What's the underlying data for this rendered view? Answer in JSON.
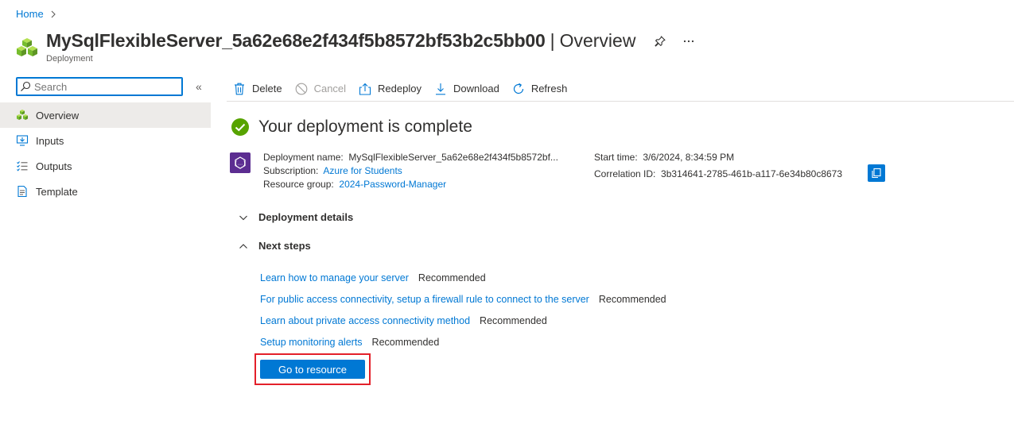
{
  "breadcrumb": {
    "home": "Home"
  },
  "header": {
    "title": "MySqlFlexibleServer_5a62e68e2f434f5b8572bf53b2c5bb00",
    "separator": "|",
    "section": "Overview",
    "subtitle": "Deployment"
  },
  "sidebar": {
    "search_placeholder": "Search",
    "collapse_glyph": "«",
    "items": [
      {
        "label": "Overview",
        "icon": "overview-icon",
        "active": true
      },
      {
        "label": "Inputs",
        "icon": "inputs-icon"
      },
      {
        "label": "Outputs",
        "icon": "outputs-icon"
      },
      {
        "label": "Template",
        "icon": "template-icon"
      }
    ]
  },
  "toolbar": {
    "delete": "Delete",
    "cancel": "Cancel",
    "redeploy": "Redeploy",
    "download": "Download",
    "refresh": "Refresh"
  },
  "status": {
    "text": "Your deployment is complete"
  },
  "details": {
    "deployment_name_label": "Deployment name:",
    "deployment_name": "MySqlFlexibleServer_5a62e68e2f434f5b8572bf...",
    "subscription_label": "Subscription:",
    "subscription": "Azure for Students",
    "resource_group_label": "Resource group:",
    "resource_group": "2024-Password-Manager",
    "start_time_label": "Start time:",
    "start_time": "3/6/2024, 8:34:59 PM",
    "correlation_id_label": "Correlation ID:",
    "correlation_id": "3b314641-2785-461b-a117-6e34b80c8673"
  },
  "sections": {
    "deployment_details": "Deployment details",
    "next_steps": "Next steps"
  },
  "next_steps": [
    {
      "link": "Learn how to manage your server",
      "tag": "Recommended"
    },
    {
      "link": "For public access connectivity, setup a firewall rule to connect to the server",
      "tag": "Recommended"
    },
    {
      "link": "Learn about private access connectivity method",
      "tag": "Recommended"
    },
    {
      "link": "Setup monitoring alerts",
      "tag": "Recommended"
    }
  ],
  "go_to_resource": "Go to resource",
  "colors": {
    "accent": "#0078d4",
    "success": "#57a300",
    "highlight": "#e3202a",
    "deployment_icon": "#5c2d91"
  }
}
